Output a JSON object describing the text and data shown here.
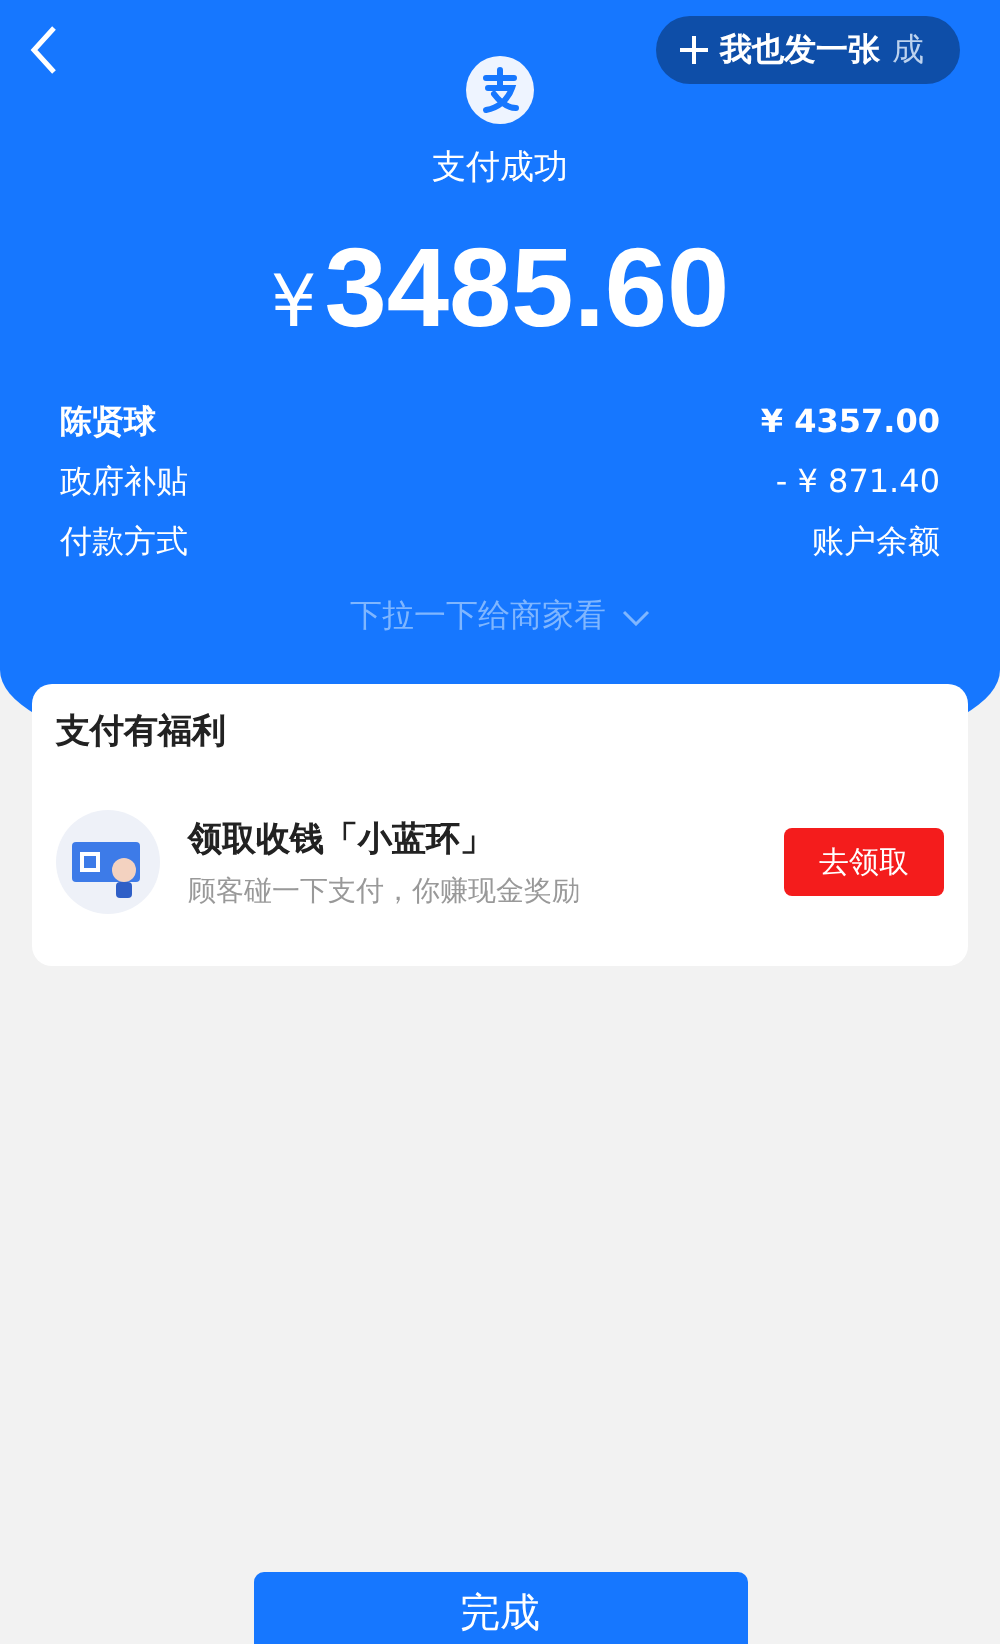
{
  "top_button": {
    "label": "我也发一张",
    "overlap_text": "成"
  },
  "status": "支付成功",
  "amount": {
    "currency": "¥",
    "value": "3485.60"
  },
  "details": [
    {
      "label": "陈贤球",
      "value": "¥ 4357.00",
      "bold": true
    },
    {
      "label": "政府补贴",
      "value": "- ¥ 871.40",
      "bold": false
    },
    {
      "label": "付款方式",
      "value": "账户余额",
      "bold": false
    }
  ],
  "pull_hint": "下拉一下给商家看",
  "benefit_card": {
    "title": "支付有福利",
    "item": {
      "title": "领取收钱「小蓝环」",
      "subtitle": "顾客碰一下支付，你赚现金奖励",
      "button": "去领取"
    }
  },
  "done_button": "完成"
}
